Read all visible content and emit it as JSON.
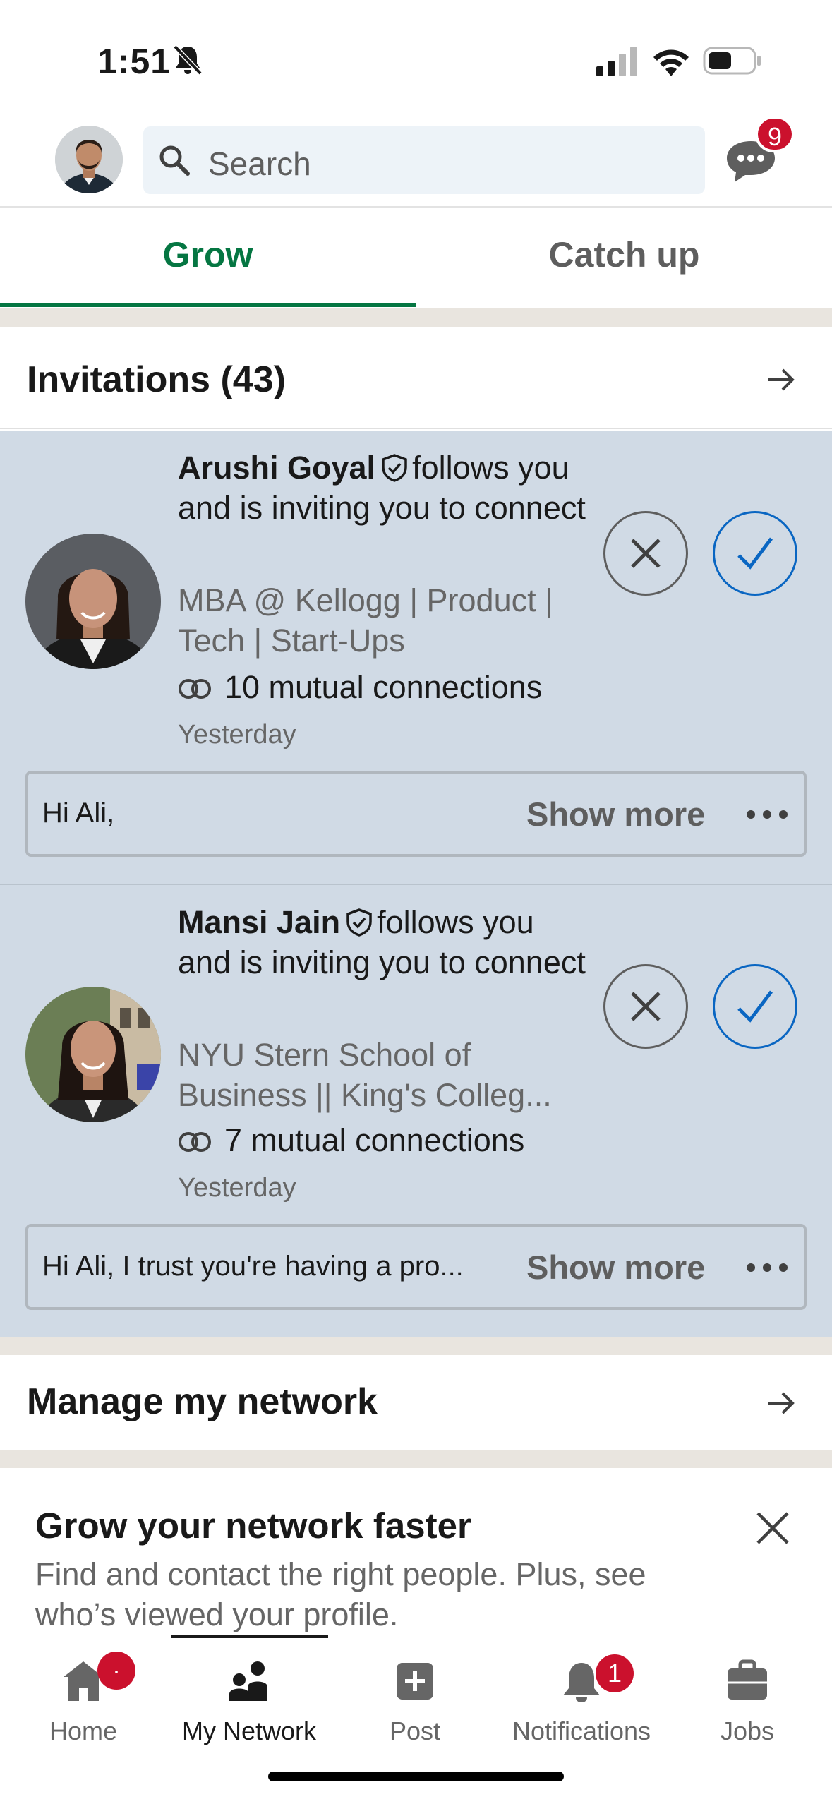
{
  "status_bar": {
    "time": "1:51"
  },
  "header": {
    "search_placeholder": "Search",
    "messages_badge": "9"
  },
  "tabs": [
    {
      "label": "Grow",
      "active": true
    },
    {
      "label": "Catch up",
      "active": false
    }
  ],
  "invitations": {
    "title": "Invitations (43)",
    "items": [
      {
        "name": "Arushi Goyal",
        "action_text": "follows you and is inviting you to connect",
        "headline": "MBA @ Kellogg | Product | Tech | Start-Ups",
        "mutual": "10 mutual connections",
        "when": "Yesterday",
        "message": "Hi Ali,",
        "show_more": "Show more"
      },
      {
        "name": "Mansi Jain",
        "action_text": "follows you and is inviting you to connect",
        "headline": "NYU Stern School of Business || King's Colleg...",
        "mutual": "7 mutual connections",
        "when": "Yesterday",
        "message": "Hi Ali, I trust you're having a pro...",
        "show_more": "Show more"
      }
    ]
  },
  "manage": {
    "title": "Manage my network"
  },
  "grow_card": {
    "title": "Grow your network faster",
    "body": "Find and contact the right people. Plus, see who’s viewed your profile."
  },
  "bottom_nav": [
    {
      "label": "Home",
      "icon": "home-icon",
      "badge": "·"
    },
    {
      "label": "My Network",
      "icon": "network-icon",
      "active": true
    },
    {
      "label": "Post",
      "icon": "post-icon"
    },
    {
      "label": "Notifications",
      "icon": "bell-icon",
      "badge": "1"
    },
    {
      "label": "Jobs",
      "icon": "briefcase-icon"
    }
  ],
  "colors": {
    "accent_green": "#057642",
    "accept_blue": "#0a66c2",
    "card_bg": "#d0dae5",
    "badge_red": "#cb112d"
  }
}
